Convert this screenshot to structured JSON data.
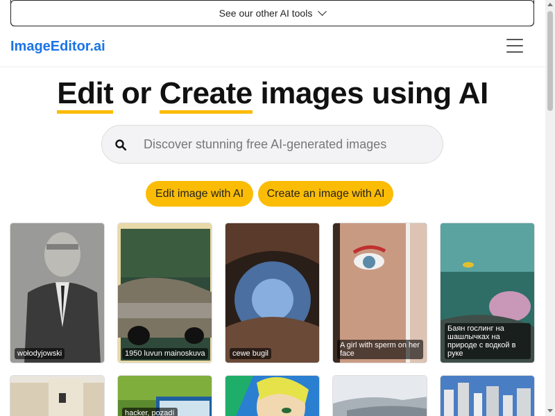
{
  "banner": {
    "label": "See our other AI tools"
  },
  "navbar": {
    "brand": "ImageEditor.ai"
  },
  "hero": {
    "title_part1": "Edit",
    "title_part2": " or ",
    "title_part3": "Create",
    "title_part4": " images using AI"
  },
  "search": {
    "placeholder": "Discover stunning free AI-generated images"
  },
  "buttons": {
    "edit": "Edit image with AI",
    "create": "Create an image with AI"
  },
  "gallery": {
    "row1": [
      {
        "caption": "wołodyjowski"
      },
      {
        "caption": "1950 luvun mainoskuva"
      },
      {
        "caption": "cewe bugil"
      },
      {
        "caption": "A girl with sperm on her face"
      },
      {
        "caption": "Баян гослинг на шашлычках на природе с водкой в руке"
      }
    ],
    "row2": [
      {
        "caption": ""
      },
      {
        "caption": "hacker, pozadí"
      },
      {
        "caption": ""
      },
      {
        "caption": ""
      },
      {
        "caption": ""
      }
    ]
  },
  "colors": {
    "brand": "#1a73e8",
    "accent": "#fbbc05"
  }
}
